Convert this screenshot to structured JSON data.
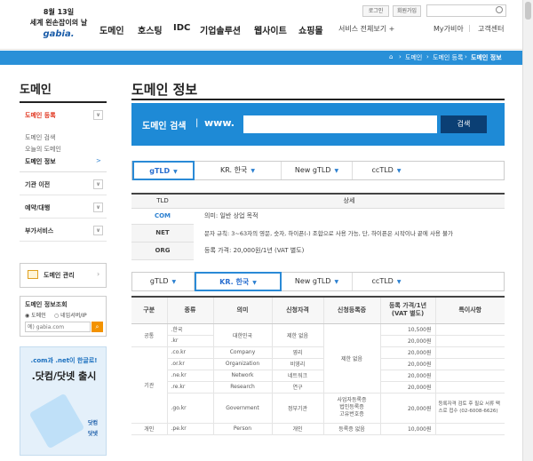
{
  "header": {
    "logo_line1": "8월 13일",
    "logo_line2": "세계 왼손잡이의 날",
    "logo_brand": "gabia.",
    "gnb": [
      "도메인",
      "호스팅",
      "IDC",
      "기업솔루션",
      "웹사이트",
      "쇼핑몰"
    ],
    "service_all": "서비스 전체보기 +",
    "my_gabia": "My가비아",
    "customer_center": "고객센터",
    "login": "로그인",
    "signup": "회원가입"
  },
  "breadcrumb": [
    "도메인",
    "도메인 등록",
    "도메인 정보"
  ],
  "sidebar": {
    "title": "도메인",
    "section_active": "도메인 등록",
    "sub_items": [
      "도메인 검색",
      "오늘의 도메인",
      "도메인 정보"
    ],
    "sub_arrow": ">",
    "sections": [
      "기관 이전",
      "예약/대행",
      "부가서비스"
    ],
    "manage_button": "도메인 관리",
    "inquiry_title": "도메인 정보조회",
    "inquiry_radio1": "도메인",
    "inquiry_radio2": "네임서버/IP",
    "inquiry_placeholder": "예) gabia.com",
    "banner_line1": ".com과 .net이 한글로!",
    "banner_line2": ".닷컴/닷넷 출시",
    "banner_tag1": "닷컴",
    "banner_tag2": "닷넷"
  },
  "main": {
    "title": "도메인 정보",
    "search_label": "도메인 검색",
    "search_prefix": "www.",
    "search_button": "검색",
    "tabs": [
      "gTLD",
      "KR. 한국",
      "New gTLD",
      "ccTLD"
    ],
    "tld_header": "TLD",
    "detail_header": "상세",
    "tld_list": [
      "COM",
      "NET",
      "ORG"
    ],
    "details": [
      "의미: 일반 상업 목적",
      "문자 규칙: 3~63자의 영문, 숫자, 하이픈(-) 조합으로 사용 가능, 단, 하이픈은 시작이나 끝에 사용 불가",
      "등록 가격: 20,000원/1년 (VAT 별도)"
    ]
  },
  "price_table": {
    "headers": [
      "구분",
      "종류",
      "의미",
      "신청자격",
      "신청등록증",
      "등록 가격/1년\n(VAT 별도)",
      "특이사항"
    ],
    "rows": [
      [
        "공통",
        ".한국",
        "대한민국",
        "제한 없음",
        "제한 없음",
        "10,500원",
        ""
      ],
      [
        "",
        ".kr",
        "",
        "",
        "",
        "20,000원",
        ""
      ],
      [
        "기관",
        ".co.kr",
        "Company",
        "영리",
        "",
        "20,000원",
        ""
      ],
      [
        "",
        ".or.kr",
        "Organization",
        "비영리",
        "",
        "20,000원",
        ""
      ],
      [
        "",
        ".ne.kr",
        "Network",
        "네트워크",
        "",
        "20,000원",
        ""
      ],
      [
        "",
        ".re.kr",
        "Research",
        "연구",
        "",
        "20,000원",
        ""
      ],
      [
        "",
        ".go.kr",
        "Government",
        "정부기관",
        "사업자등록증\n법인등록증\n고유번호증",
        "20,000원",
        "등록자격 검토 후 필요 서류 팩스로 접수 (02-6008-6626)"
      ],
      [
        "개인",
        ".pe.kr",
        "Person",
        "개인",
        "등록증 없음",
        "10,000원",
        ""
      ]
    ]
  },
  "colors": {
    "accent": "#1e8ad6",
    "bar": "#2990d8",
    "active_red": "#e0321b"
  },
  "icons": [
    "home-icon",
    "search-icon",
    "folder-icon",
    "chevron-icon"
  ]
}
